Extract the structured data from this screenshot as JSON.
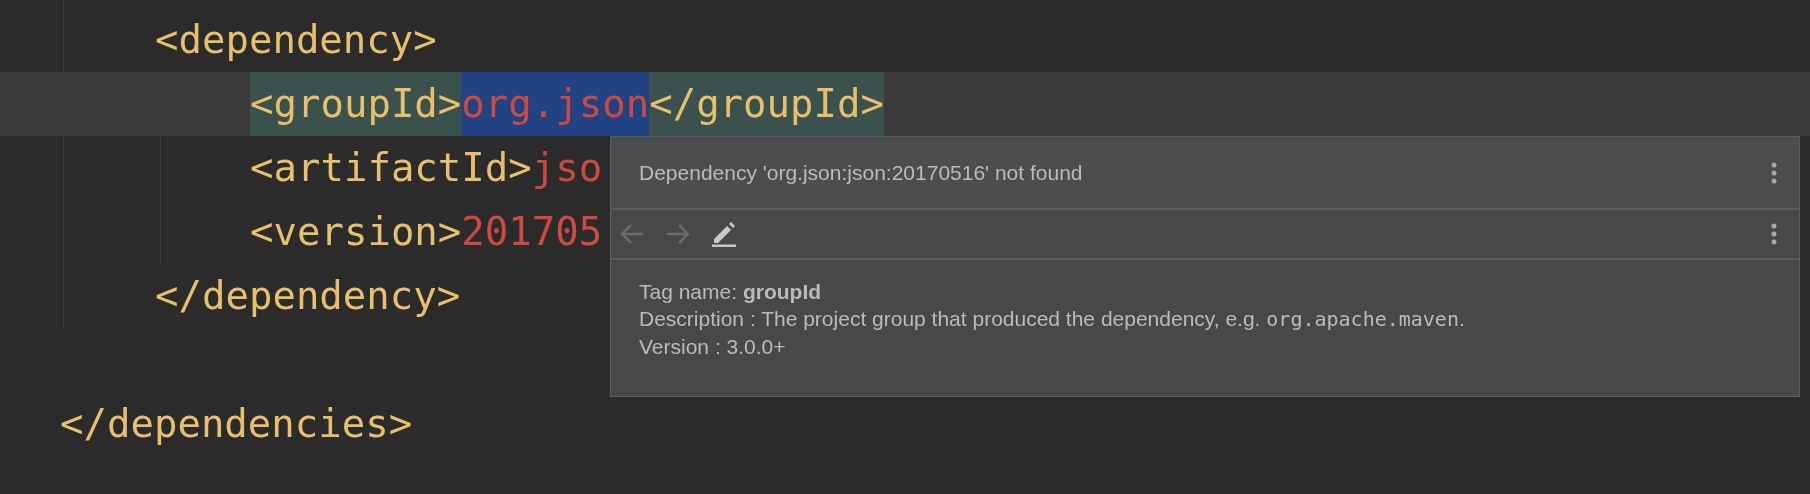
{
  "code": {
    "lines": [
      {
        "kind": "group",
        "children": [
          {
            "kind": "line",
            "current": false,
            "tokens": [
              {
                "kind": "tag",
                "text": "<dependency>"
              }
            ],
            "children": [
              {
                "kind": "line",
                "current": true,
                "tokens": [
                  {
                    "kind": "tag",
                    "text": "<groupId>",
                    "paired": true,
                    "selected": false
                  },
                  {
                    "kind": "value",
                    "text": "org.json",
                    "paired": false,
                    "selected": true
                  },
                  {
                    "kind": "tag",
                    "text": "</groupId>",
                    "paired": true,
                    "selected": false
                  }
                ]
              },
              {
                "kind": "line",
                "current": false,
                "tokens": [
                  {
                    "kind": "tag",
                    "text": "<artifactId>"
                  },
                  {
                    "kind": "value",
                    "text": "jso"
                  }
                ]
              },
              {
                "kind": "line",
                "current": false,
                "tokens": [
                  {
                    "kind": "tag",
                    "text": "<version>"
                  },
                  {
                    "kind": "value",
                    "text": "201705"
                  }
                ]
              }
            ]
          },
          {
            "kind": "line",
            "current": false,
            "tokens": [
              {
                "kind": "tag",
                "text": "</dependency>"
              }
            ]
          }
        ]
      },
      {
        "kind": "blank"
      },
      {
        "kind": "line",
        "current": false,
        "tokens": [
          {
            "kind": "tag",
            "text": "</dependencies>"
          }
        ]
      }
    ]
  },
  "popup": {
    "title": "Dependency 'org.json:json:20170516' not found",
    "toolbar": [
      {
        "kind": "back",
        "disabled": true
      },
      {
        "kind": "forward",
        "disabled": true
      },
      {
        "kind": "edit",
        "disabled": false
      }
    ],
    "tag_name": "Tag name: **groupId**",
    "description": {
      "text": "Description : The project group that produced the dependency, e.g. ",
      "code": "org.apache.maven",
      "suffix": "."
    },
    "version": "Version : 3.0.0+"
  }
}
